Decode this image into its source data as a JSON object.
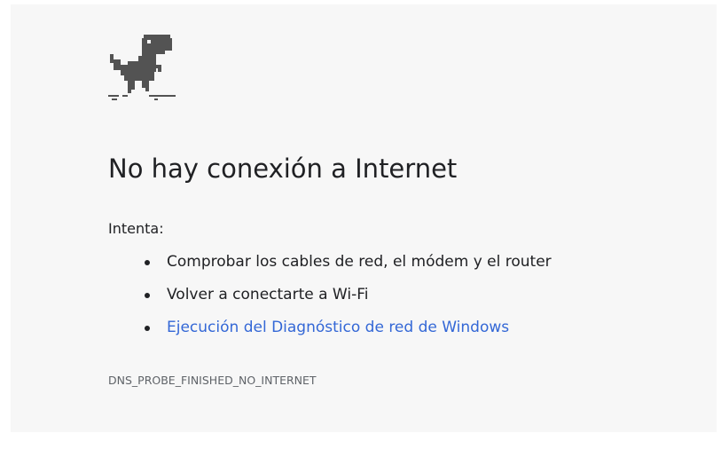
{
  "icon": "dinosaur-icon",
  "title": "No hay conexión a Internet",
  "suggestions": {
    "label": "Intenta:",
    "items": [
      {
        "text": "Comprobar los cables de red, el módem y el router"
      },
      {
        "text": "Volver a conectarte a Wi-Fi"
      },
      {
        "text": "Ejecución del Diagnóstico de red de Windows"
      }
    ]
  },
  "error_code": "DNS_PROBE_FINISHED_NO_INTERNET",
  "colors": {
    "background": "#f7f7f7",
    "text": "#202124",
    "link": "#3367d6",
    "dino": "#535353"
  }
}
